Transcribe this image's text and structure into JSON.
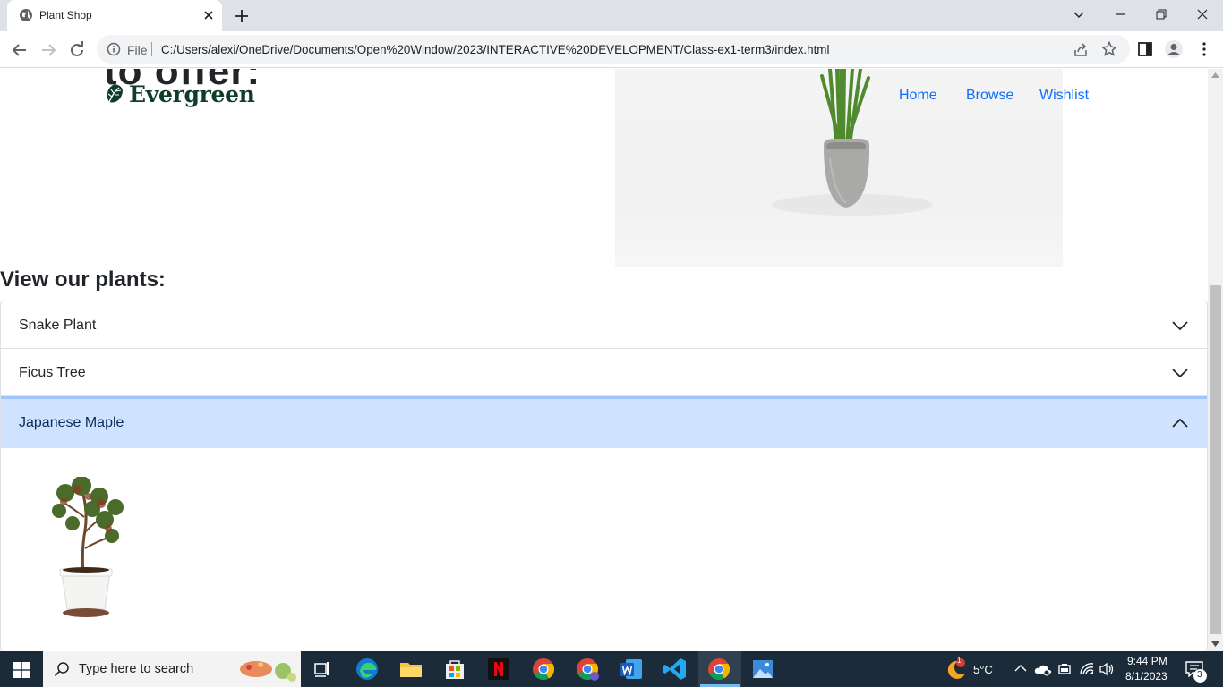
{
  "browser": {
    "tab_title": "Plant Shop",
    "scheme_label": "File",
    "url": "C:/Users/alexi/OneDrive/Documents/Open%20Window/2023/INTERACTIVE%20DEVELOPMENT/Class-ex1-term3/index.html"
  },
  "page": {
    "hero_partial_text": "to offer:",
    "logo_text": "Evergreen",
    "nav": [
      "Home",
      "Browse",
      "Wishlist"
    ],
    "section_title": "View our plants:",
    "accordion": [
      {
        "label": "Snake Plant",
        "expanded": false
      },
      {
        "label": "Ficus Tree",
        "expanded": false
      },
      {
        "label": "Japanese Maple",
        "expanded": true
      }
    ]
  },
  "taskbar": {
    "search_placeholder": "Type here to search",
    "weather": "5°C",
    "weather_badge": "1",
    "time": "9:44 PM",
    "date": "8/1/2023",
    "notification_count": "3",
    "apps": [
      "task-view",
      "edge",
      "file-explorer",
      "microsoft-store",
      "netflix",
      "chrome",
      "chrome-profile",
      "word",
      "vscode",
      "chrome-active",
      "photos"
    ]
  },
  "colors": {
    "link": "#0d6efd",
    "accordion_open_bg": "#cfe2ff",
    "logo": "#0f3d2a",
    "taskbar": "#1c2b3a"
  }
}
